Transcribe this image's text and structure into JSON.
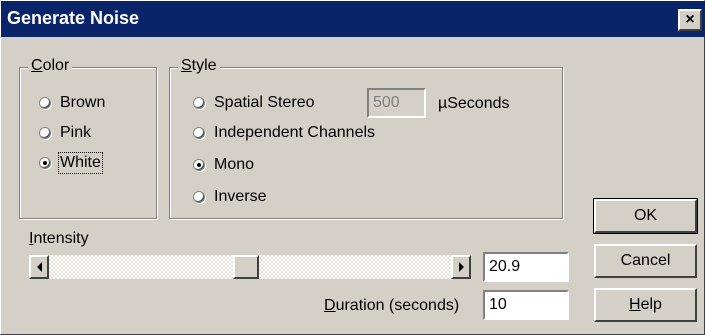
{
  "window": {
    "title": "Generate Noise",
    "close_glyph": "×"
  },
  "color_group": {
    "legend_first": "C",
    "legend_rest": "olor",
    "options": [
      {
        "label": "Brown",
        "selected": false
      },
      {
        "label": "Pink",
        "selected": false
      },
      {
        "label": "White",
        "selected": true
      }
    ]
  },
  "style_group": {
    "legend_first": "S",
    "legend_rest": "tyle",
    "options": [
      {
        "label": "Spatial Stereo",
        "selected": false
      },
      {
        "label": "Independent Channels",
        "selected": false
      },
      {
        "label": "Mono",
        "selected": true
      },
      {
        "label": "Inverse",
        "selected": false
      }
    ],
    "delay_value": "500",
    "delay_unit": "µSeconds"
  },
  "intensity": {
    "label_first": "I",
    "label_rest": "ntensity",
    "value": "20.9",
    "slider_fraction": 0.49
  },
  "duration": {
    "label_first": "D",
    "label_rest": "uration (seconds)",
    "value": "10"
  },
  "buttons": {
    "ok": "OK",
    "cancel": "Cancel",
    "help_first": "H",
    "help_rest": "elp"
  },
  "icons": {
    "close": "close-icon",
    "scroll_left": "scroll-left-arrow-icon",
    "scroll_right": "scroll-right-arrow-icon"
  }
}
